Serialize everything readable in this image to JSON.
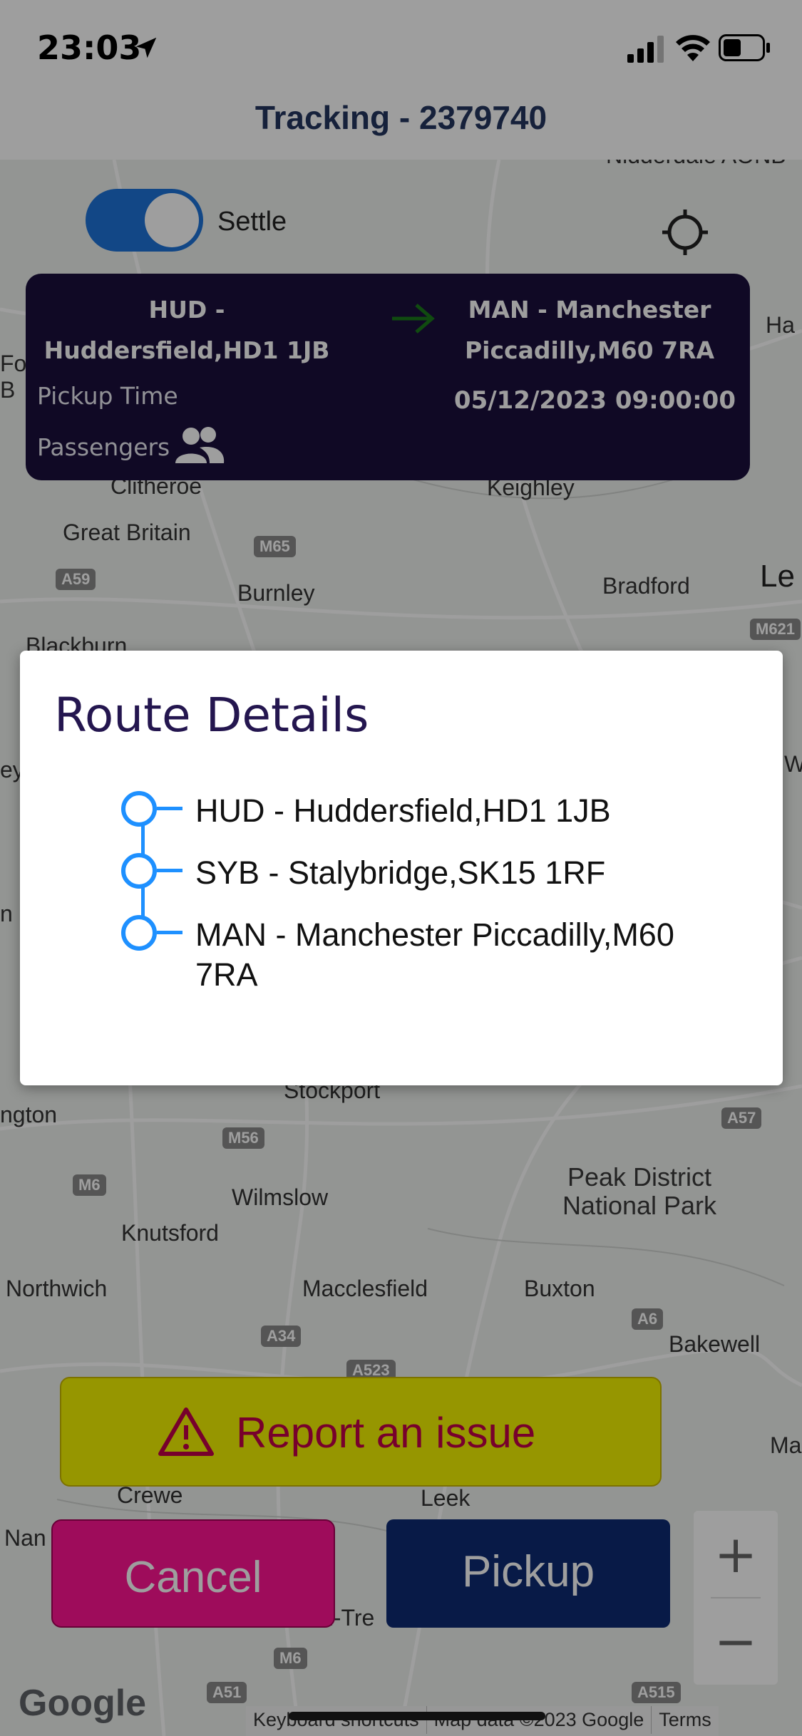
{
  "status_bar": {
    "time": "23:03",
    "icons": [
      "location-arrow-icon",
      "cellular-signal-icon",
      "wifi-icon",
      "battery-icon"
    ]
  },
  "header": {
    "title": "Tracking - 2379740"
  },
  "map": {
    "places": [
      "Nidderdale AONB",
      "Clitheroe",
      "Keighley",
      "Great Britain",
      "Burnley",
      "Bradford",
      "Le",
      "Blackburn",
      "Ha",
      "Stockport",
      "ngton",
      "Wilmslow",
      "Knutsford",
      "Peak District National Park",
      "Northwich",
      "Macclesfield",
      "Buxton",
      "Bakewell",
      "Crewe",
      "Nan",
      "n-Tre",
      "Ma",
      "Leek",
      "Fo B",
      "ey",
      "n",
      "W"
    ],
    "road_labels": [
      "M65",
      "A59",
      "M621",
      "M56",
      "M6",
      "A34",
      "A57",
      "A6",
      "A523",
      "M6",
      "A51",
      "A515"
    ],
    "google_logo": "Google",
    "attribution": [
      "Keyboard shortcuts",
      "Map data ©2023 Google",
      "Terms"
    ]
  },
  "controls": {
    "toggle_label": "Settle",
    "toggle_on": true
  },
  "job_card": {
    "from": "HUD - Huddersfield,HD1 1JB",
    "to": "MAN - Manchester Piccadilly,M60 7RA",
    "pickup_time_label": "Pickup Time",
    "pickup_datetime": "05/12/2023 09:00:00",
    "passengers_label": "Passengers",
    "icons": {
      "arrow": "arrow-right-icon",
      "passengers": "people-icon"
    },
    "colors": {
      "card": "#1b0f3d",
      "arrow": "#1a7a1a"
    }
  },
  "modal": {
    "title": "Route Details",
    "stops": [
      "HUD - Huddersfield,HD1 1JB",
      "SYB - Stalybridge,SK15 1RF",
      "MAN - Manchester Piccadilly,M60 7RA"
    ]
  },
  "actions": {
    "report_label": "Report an issue",
    "cancel_label": "Cancel",
    "pickup_label": "Pickup",
    "zoom_in": "+",
    "zoom_out": "−",
    "colors": {
      "report": "#f2f200",
      "cancel": "#ff1493",
      "pickup": "#0e2a73"
    }
  }
}
